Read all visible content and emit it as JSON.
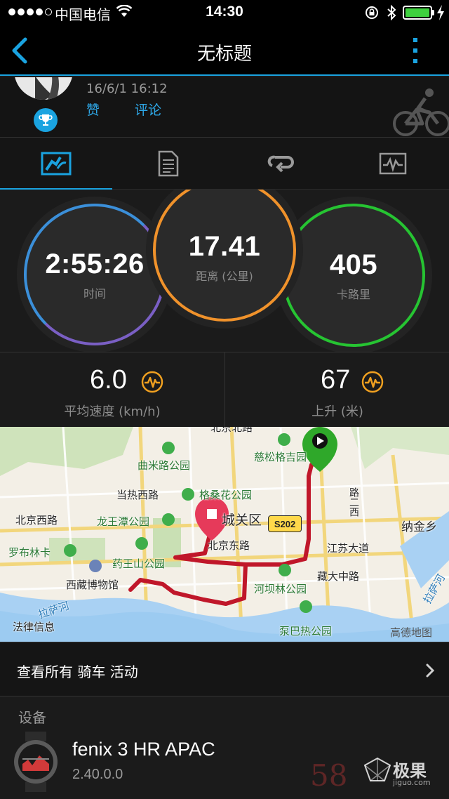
{
  "status_bar": {
    "carrier": "中国电信",
    "time": "14:30",
    "battery_percent": 100
  },
  "nav": {
    "title": "无标题",
    "back_icon": "chevron-left-icon",
    "more_icon": "more-vertical-icon"
  },
  "activity": {
    "date": "16/6/1 16:12",
    "like_label": "赞",
    "comment_label": "评论",
    "type_icon": "cycling-icon"
  },
  "tabs": [
    {
      "name": "overview",
      "icon": "overview-icon",
      "active": true
    },
    {
      "name": "details",
      "icon": "document-icon",
      "active": false
    },
    {
      "name": "laps",
      "icon": "loop-icon",
      "active": false
    },
    {
      "name": "charts",
      "icon": "chart-icon",
      "active": false
    }
  ],
  "metrics": {
    "time": {
      "value": "2:55:26",
      "label": "时间",
      "color": "#3b8fd9"
    },
    "distance": {
      "value": "17.41",
      "label": "距离 (公里)",
      "color": "#f0922b"
    },
    "calories": {
      "value": "405",
      "label": "卡路里",
      "color": "#26c432"
    }
  },
  "stats": {
    "avg_speed": {
      "value": "6.0",
      "label": "平均速度 (km/h)"
    },
    "ascent": {
      "value": "67",
      "label": "上升 (米)"
    }
  },
  "map": {
    "labels": {
      "beijing_north_road": "北京北路",
      "qumilu_park": "曲米路公园",
      "songge_park": "慈松格吉园",
      "dangre_west_road": "当热西路",
      "gesanghua_park": "格桑花公园",
      "district": "城关区",
      "beijing_west_road": "北京西路",
      "longwangtan_park": "龙王潭公园",
      "naijin": "纳金乡",
      "road_s202": "S202",
      "beijing_east_road": "北京东路",
      "jiangsu_road": "江苏大道",
      "lubu_linka": "罗布林卡",
      "yaowangshan_park": "药王山公园",
      "zangda_middle_road": "藏大中路",
      "tibet_museum": "西藏博物馆",
      "heba_park": "河坝林公园",
      "lhasa_river": "拉萨河",
      "lhasa_river_right": "拉萨河",
      "legal": "法律信息",
      "pobare_park": "泵巴热公园",
      "gaode": "高德地图",
      "road_vertical": "路二西"
    }
  },
  "all_activities": {
    "label": "查看所有 骑车 活动"
  },
  "device": {
    "section_title": "设备",
    "name": "fenix 3 HR APAC",
    "version": "2.40.0.0"
  },
  "watermark": {
    "brand": "极果",
    "site": "jiguo.com",
    "mark": "58"
  }
}
